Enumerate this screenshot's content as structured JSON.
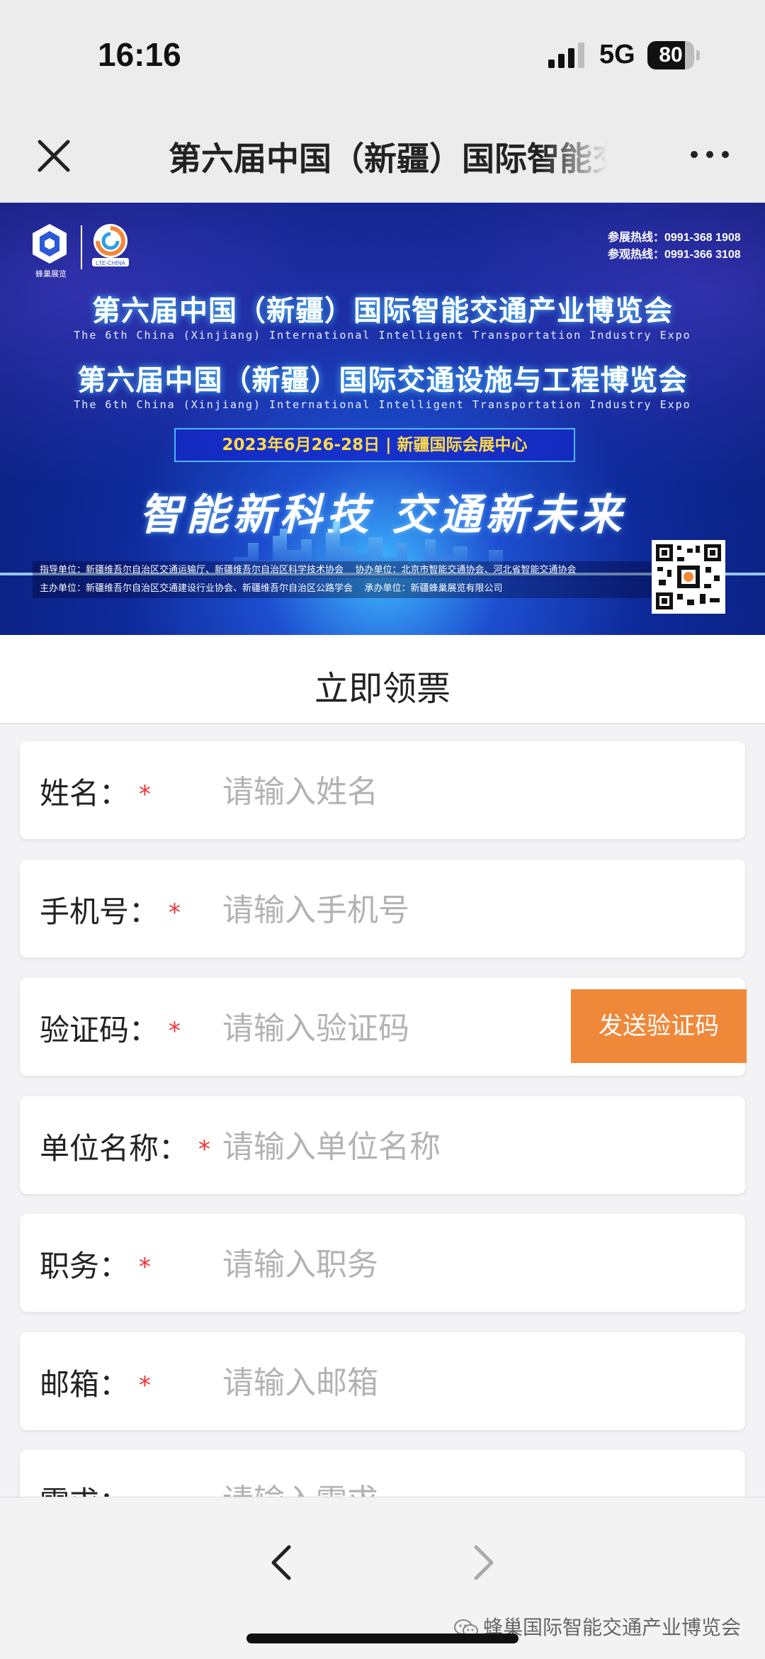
{
  "status_bar": {
    "time": "16:16",
    "network": "5G",
    "battery": "80",
    "battery_level": 0.8
  },
  "nav_bar": {
    "title": "第六届中国（新疆）国际智能交通产业博览会",
    "close_icon": "close-icon",
    "more_icon": "more-icon"
  },
  "banner": {
    "logo_caption": "蜂巢展览",
    "logo_b_caption": "LTE-CHINA",
    "hotline_1": "参展热线：0991-368 1908",
    "hotline_2": "参观热线：0991-366 3108",
    "title_1": "第六届中国（新疆）国际智能交通产业博览会",
    "subtitle_1": "The 6th China (Xinjiang) International Intelligent Transportation Industry Expo",
    "title_2": "第六届中国（新疆）国际交通设施与工程博览会",
    "subtitle_2": "The 6th China (Xinjiang) International Intelligent Transportation Industry Expo",
    "date_venue": "2023年6月26-28日  |  新疆国际会展中心",
    "slogan": "智能新科技  交通新未来",
    "guide_units": "指导单位：新疆维吾尔自治区交通运输厅、新疆维吾尔自治区科学技术协会",
    "co_units": "协办单位：北京市智能交通协会、河北省智能交通协会",
    "host_units": "主办单位：新疆维吾尔自治区交通建设行业协会、新疆维吾尔自治区公路学会",
    "organizer": "承办单位：新疆蜂巢展览有限公司"
  },
  "section": {
    "title": "立即领票"
  },
  "form": {
    "name": {
      "label": "姓名：",
      "required": "*",
      "placeholder": "请输入姓名"
    },
    "phone": {
      "label": "手机号：",
      "required": "*",
      "placeholder": "请输入手机号"
    },
    "code": {
      "label": "验证码：",
      "required": "*",
      "placeholder": "请输入验证码",
      "send_label": "发送验证码"
    },
    "company": {
      "label": "单位名称：",
      "required": "*",
      "placeholder": "请输入单位名称"
    },
    "position": {
      "label": "职务：",
      "required": "*",
      "placeholder": "请输入职务"
    },
    "email": {
      "label": "邮箱：",
      "required": "*",
      "placeholder": "请输入邮箱"
    },
    "needs": {
      "label": "需求：",
      "placeholder": "请输入需求"
    }
  },
  "bottom_bar": {
    "watermark": "蜂巢国际智能交通产业博览会",
    "back_icon": "back-arrow-icon",
    "forward_icon": "forward-arrow-icon"
  },
  "colors": {
    "accent": "#f0883a",
    "required": "#e33333",
    "banner_dark": "#081a6e"
  }
}
